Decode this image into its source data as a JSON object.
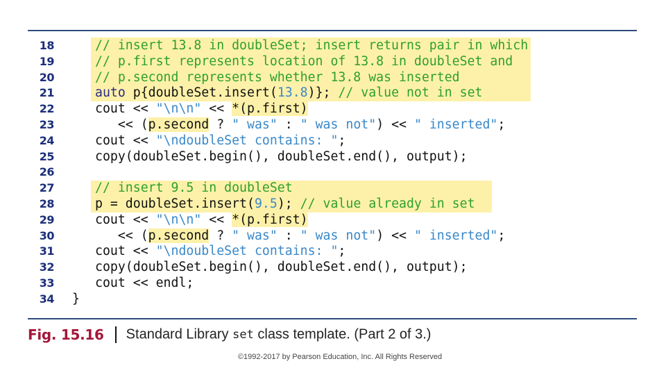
{
  "figure": {
    "label": "Fig. 15.16",
    "caption_prefix": "Standard Library ",
    "caption_code": "set",
    "caption_suffix": " class template. (Part 2 of 3.)"
  },
  "copyright": "©1992-2017 by Pearson Education, Inc. All Rights Reserved",
  "colors": {
    "rule": "#2c4a7e",
    "line_number": "#1b2f7a",
    "highlight": "#fdf1a9",
    "comment": "#2e9f2e",
    "string": "#3a88c8",
    "keyword": "#2a2a86",
    "figure_label": "#a3173a"
  },
  "code_lines": [
    {
      "number": "18",
      "segments": [
        {
          "t": "// insert 13.8 in doubleSet; insert returns pair in which",
          "k": "comment"
        }
      ]
    },
    {
      "number": "19",
      "segments": [
        {
          "t": "// p.first represents location of 13.8 in doubleSet and",
          "k": "comment"
        }
      ]
    },
    {
      "number": "20",
      "segments": [
        {
          "t": "// p.second represents whether 13.8 was inserted",
          "k": "comment"
        }
      ]
    },
    {
      "number": "21",
      "segments": [
        {
          "t": "auto",
          "k": "kw"
        },
        {
          "t": " p{doubleSet.insert(",
          "k": "plain"
        },
        {
          "t": "13.8",
          "k": "num"
        },
        {
          "t": ")}; ",
          "k": "plain"
        },
        {
          "t": "// value not in set",
          "k": "comment"
        }
      ]
    },
    {
      "number": "22",
      "segments": [
        {
          "t": "cout << ",
          "k": "plain"
        },
        {
          "t": "\"\\n\\n\"",
          "k": "str"
        },
        {
          "t": " << ",
          "k": "plain"
        },
        {
          "t": "*(p.first)",
          "k": "hl"
        }
      ]
    },
    {
      "number": "23",
      "segments": [
        {
          "t": "   << (",
          "k": "plain"
        },
        {
          "t": "p.second",
          "k": "hl"
        },
        {
          "t": " ? ",
          "k": "plain"
        },
        {
          "t": "\" was\"",
          "k": "str"
        },
        {
          "t": " : ",
          "k": "plain"
        },
        {
          "t": "\" was not\"",
          "k": "str"
        },
        {
          "t": ") << ",
          "k": "plain"
        },
        {
          "t": "\" inserted\"",
          "k": "str"
        },
        {
          "t": ";",
          "k": "plain"
        }
      ]
    },
    {
      "number": "24",
      "segments": [
        {
          "t": "cout << ",
          "k": "plain"
        },
        {
          "t": "\"\\ndoubleSet contains: \"",
          "k": "str"
        },
        {
          "t": ";",
          "k": "plain"
        }
      ]
    },
    {
      "number": "25",
      "segments": [
        {
          "t": "copy(doubleSet.begin(), doubleSet.end(), output);",
          "k": "plain"
        }
      ]
    },
    {
      "number": "26",
      "segments": []
    },
    {
      "number": "27",
      "segments": [
        {
          "t": "// insert 9.5 in doubleSet",
          "k": "comment"
        }
      ]
    },
    {
      "number": "28",
      "segments": [
        {
          "t": "p = doubleSet.insert(",
          "k": "plain"
        },
        {
          "t": "9.5",
          "k": "num"
        },
        {
          "t": "); ",
          "k": "plain"
        },
        {
          "t": "// value already in set",
          "k": "comment"
        }
      ]
    },
    {
      "number": "29",
      "segments": [
        {
          "t": "cout << ",
          "k": "plain"
        },
        {
          "t": "\"\\n\\n\"",
          "k": "str"
        },
        {
          "t": " << ",
          "k": "plain"
        },
        {
          "t": "*(p.first)",
          "k": "hl"
        }
      ]
    },
    {
      "number": "30",
      "segments": [
        {
          "t": "   << (",
          "k": "plain"
        },
        {
          "t": "p.second",
          "k": "hl"
        },
        {
          "t": " ? ",
          "k": "plain"
        },
        {
          "t": "\" was\"",
          "k": "str"
        },
        {
          "t": " : ",
          "k": "plain"
        },
        {
          "t": "\" was not\"",
          "k": "str"
        },
        {
          "t": ") << ",
          "k": "plain"
        },
        {
          "t": "\" inserted\"",
          "k": "str"
        },
        {
          "t": ";",
          "k": "plain"
        }
      ]
    },
    {
      "number": "31",
      "segments": [
        {
          "t": "cout << ",
          "k": "plain"
        },
        {
          "t": "\"\\ndoubleSet contains: \"",
          "k": "str"
        },
        {
          "t": ";",
          "k": "plain"
        }
      ]
    },
    {
      "number": "32",
      "segments": [
        {
          "t": "copy(doubleSet.begin(), doubleSet.end(), output);",
          "k": "plain"
        }
      ]
    },
    {
      "number": "33",
      "segments": [
        {
          "t": "cout << endl;",
          "k": "plain"
        }
      ]
    },
    {
      "number": "34",
      "segments": [
        {
          "t": "}",
          "k": "plain"
        }
      ],
      "outdent": true
    }
  ]
}
